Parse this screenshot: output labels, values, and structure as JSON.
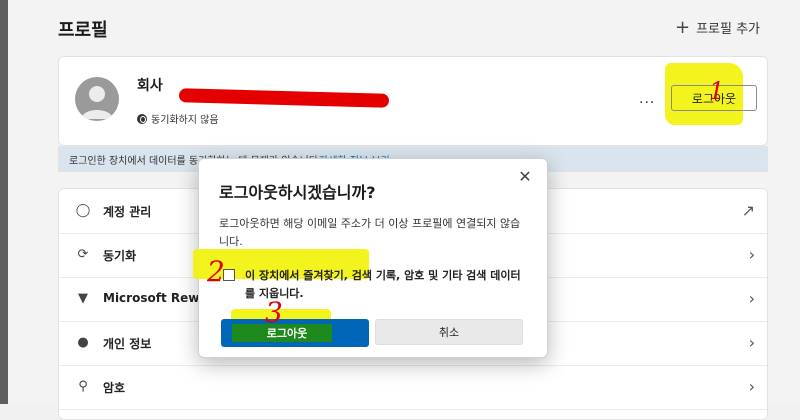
{
  "header": {
    "title": "프로필",
    "add_profile": "프로필 추가"
  },
  "profile": {
    "name": "회사",
    "sync_status": "동기화하지 않음",
    "more": "...",
    "logout_button": "로그아웃"
  },
  "infobar": {
    "text": "로그인한 장치에서 데이터를 동기화하는 데 문제가 있습니다.",
    "link": "자세한 정보 보기"
  },
  "settings": {
    "items": [
      {
        "label": "계정 관리",
        "icon": "person-icon",
        "action": "external-link-icon"
      },
      {
        "label": "동기화",
        "icon": "sync-icon",
        "action": "chevron-right-icon"
      },
      {
        "label": "Microsoft Rewa",
        "icon": "trophy-icon",
        "action": "chevron-right-icon"
      },
      {
        "label": "개인 정보",
        "icon": "personal-info-icon",
        "action": "chevron-right-icon"
      },
      {
        "label": "암호",
        "icon": "key-icon",
        "action": "chevron-right-icon"
      }
    ]
  },
  "dialog": {
    "title": "로그아웃하시겠습니까?",
    "body": "로그아웃하면 해당 이메일 주소가 더 이상 프로필에 연결되지 않습니다.",
    "checkbox_label": "이 장치에서 즐겨찾기, 검색 기록, 암호 및 기타 검색 데이터를 지웁니다.",
    "checkbox_checked": false,
    "confirm_button": "로그아웃",
    "cancel_button": "취소"
  },
  "annotations": {
    "step1": "1",
    "step2": "2",
    "step3": "3"
  },
  "colors": {
    "highlight": "#f2f20a",
    "annotation": "#e00000",
    "primary": "#0067b8"
  }
}
